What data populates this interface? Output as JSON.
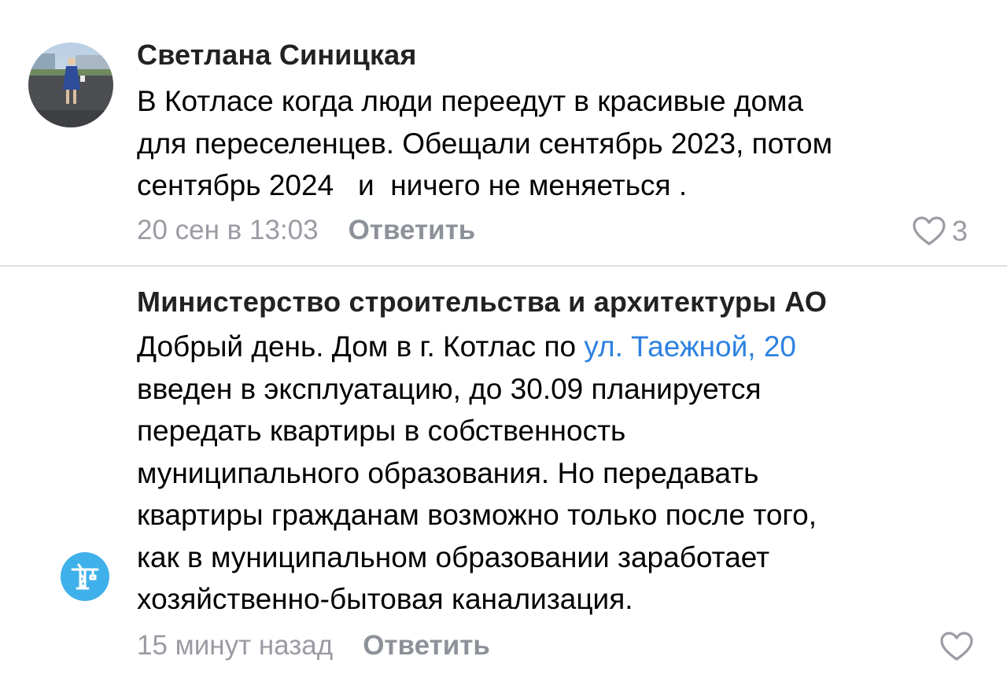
{
  "comments": [
    {
      "author": "Светлана Синицкая",
      "text": "В Котласе когда люди переедут в красивые дома\nдля переселенцев. Обещали сентябрь 2023, потом\nсентябрь 2024   и  ничего не меняеться .",
      "time": "20 сен в 13:03",
      "reply_label": "Ответить",
      "likes": "3",
      "avatar_icon": "user-photo"
    },
    {
      "author": "Министерство строительства и архитектуры АО",
      "text_before_link": "Добрый день. Дом в г. Котлас по ",
      "link_text": "ул. Таежной, 20",
      "text_after_link": "\nвведен в эксплуатацию, до 30.09 планируется\nпередать квартиры в собственность\nмуниципального образования. Но передавать\nквартиры гражданам возможно только после того,\nкак в муниципальном образовании заработает\nхозяйственно-бытовая канализация.",
      "time": "15 минут назад",
      "reply_label": "Ответить",
      "avatar_icon": "crane-icon"
    }
  ],
  "colors": {
    "link": "#2d81e0",
    "meta": "#9a9ca3",
    "org_avatar": "#3fb0ea",
    "divider": "#dcdde1"
  }
}
